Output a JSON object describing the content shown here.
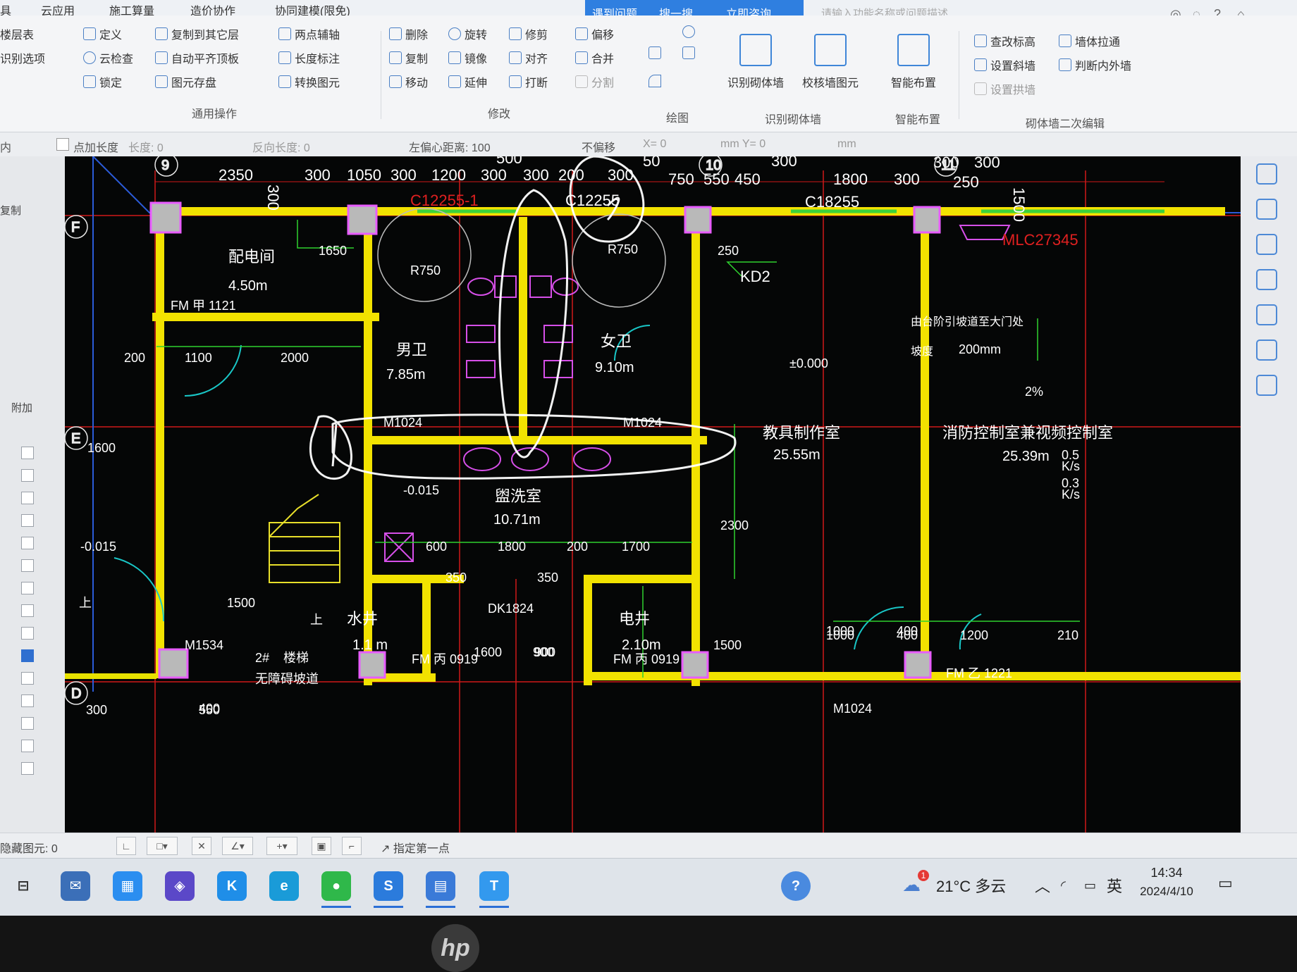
{
  "menubar": {
    "items": [
      "具",
      "云应用",
      "施工算量",
      "造价协作",
      "协同建模(限免)"
    ],
    "quick": [
      "遇到问题",
      "搜一搜",
      "立即咨询"
    ],
    "search_hint": "请输入功能名称或问题描述"
  },
  "ribbon": {
    "col1": [
      "楼层表",
      "识别选项"
    ],
    "col2": [
      "定义",
      "云检查",
      "锁定"
    ],
    "col3": [
      "复制到其它层",
      "自动平齐顶板",
      "图元存盘"
    ],
    "col4": [
      "两点辅轴",
      "长度标注",
      "转换图元"
    ],
    "general_ops": "通用操作",
    "col5": [
      "删除",
      "复制",
      "移动"
    ],
    "col6": [
      "旋转",
      "镜像",
      "延伸"
    ],
    "col7": [
      "修剪",
      "对齐",
      "打断"
    ],
    "col8": [
      "偏移",
      "合并",
      "分割"
    ],
    "modify": "修改",
    "draw": "绘图",
    "big1": "识别砌体墙",
    "big2": "校核墙图元",
    "big3": "智能布置",
    "group_recognize": "识别砌体墙",
    "group_smart": "智能布置",
    "col9": [
      "查改标高",
      "设置斜墙",
      "设置拱墙"
    ],
    "col10": [
      "墙体拉通",
      "判断内外墙",
      "砌体墙二次编辑"
    ],
    "group_secondary": "砌体墙二次编辑"
  },
  "propbar": {
    "a": "内",
    "b": "点加长度",
    "c": "长度: 0",
    "d": "反向长度: 0",
    "e": "左偏心距离: 100",
    "f": "不偏移",
    "g": "X= 0",
    "h": "mm Y= 0",
    "i": "mm"
  },
  "leftpanel": {
    "t1": "复制",
    "t2": "附加"
  },
  "drawing": {
    "axes": [
      "9",
      "10",
      "11",
      "F",
      "E",
      "D"
    ],
    "top_dims": [
      "2350",
      "300",
      "300",
      "1050",
      "300",
      "1200",
      "300",
      "300",
      "200",
      "300",
      "500",
      "50",
      "750",
      "550",
      "450",
      "300",
      "1800",
      "300",
      "300",
      "250",
      "300",
      "1500"
    ],
    "windows": [
      "C12255-1",
      "C12255",
      "C18255",
      "MLC27345",
      "KD2"
    ],
    "rooms": [
      {
        "name": "配电间",
        "area": "4.50m"
      },
      {
        "name": "男卫",
        "area": "7.85m"
      },
      {
        "name": "女卫",
        "area": "9.10m"
      },
      {
        "name": "教具制作室",
        "area": "25.55m"
      },
      {
        "name": "消防控制室兼视频控制室",
        "area": "25.39m"
      },
      {
        "name": "盥洗室",
        "area": "10.71m"
      },
      {
        "name": "电井",
        "area": "2.10m"
      },
      {
        "name": "水井",
        "area": "1.1 m"
      }
    ],
    "labels": [
      "FM 甲 1121",
      "R750",
      "R750",
      "250",
      "1650",
      "200",
      "1100",
      "2000",
      "M1024",
      "M1024",
      "±0.000",
      "1600",
      "-0.015",
      "-0.015",
      "1800",
      "200",
      "1700",
      "2300",
      "1000",
      "600",
      "350",
      "350",
      "DK1824",
      "900",
      "1600",
      "900",
      "1500",
      "400",
      "1000",
      "400",
      "1200",
      "210",
      "FM 乙 1221",
      "M1024",
      "300",
      "550",
      "M1534",
      "1500",
      "FM 丙 0919",
      "FM 丙 0919",
      "2#",
      "楼梯",
      "无障碍坡道",
      "2%",
      "200mm",
      "0.5",
      "0.3",
      "K/s",
      "K/s",
      "上",
      "上",
      "400"
    ],
    "note": "由台阶引坡道至大门处",
    "note2": "坡度"
  },
  "status": {
    "hidden": "隐藏图元: 0",
    "prompt": "指定第一点"
  },
  "taskbar": {
    "weather": "21°C 多云",
    "ime": "英",
    "time": "14:34",
    "date": "2024/4/10",
    "badge": "1"
  }
}
